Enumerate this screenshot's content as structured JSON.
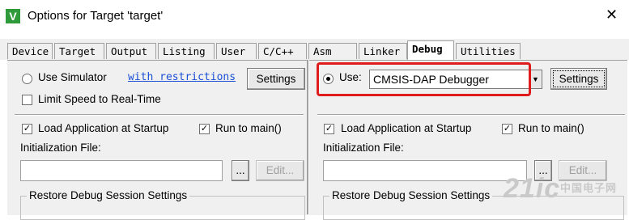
{
  "window": {
    "title": "Options for Target 'target'",
    "close_glyph": "✕",
    "app_icon_glyph": "V"
  },
  "tabs": [
    {
      "label": "Device",
      "active": false
    },
    {
      "label": "Target",
      "active": false
    },
    {
      "label": "Output",
      "active": false
    },
    {
      "label": "Listing",
      "active": false
    },
    {
      "label": "User",
      "active": false
    },
    {
      "label": "C/C++",
      "active": false
    },
    {
      "label": "Asm",
      "active": false
    },
    {
      "label": "Linker",
      "active": false
    },
    {
      "label": "Debug",
      "active": true
    },
    {
      "label": "Utilities",
      "active": false
    }
  ],
  "left": {
    "use_simulator_label": "Use Simulator",
    "with_restrictions_link": "with restrictions",
    "settings_button": "Settings",
    "limit_speed_label": "Limit Speed to Real-Time",
    "load_app_label": "Load Application at Startup",
    "run_to_main_label": "Run to main()",
    "init_file_label": "Initialization File:",
    "init_file_value": "",
    "browse_button": "...",
    "edit_button": "Edit...",
    "restore_group_title": "Restore Debug Session Settings"
  },
  "right": {
    "use_label": "Use:",
    "debugger_selected": "CMSIS-DAP Debugger",
    "settings_button": "Settings",
    "load_app_label": "Load Application at Startup",
    "run_to_main_label": "Run to main()",
    "init_file_label": "Initialization File:",
    "init_file_value": "",
    "browse_button": "...",
    "edit_button": "Edit...",
    "restore_group_title": "Restore Debug Session Settings"
  },
  "state": {
    "use_simulator_selected": false,
    "use_debugger_selected": true,
    "limit_speed_checked": false,
    "left_load_app_checked": true,
    "left_run_to_main_checked": true,
    "right_load_app_checked": true,
    "right_run_to_main_checked": true
  },
  "watermark": {
    "text": "21ic",
    "subtext": "中国电子网"
  },
  "colors": {
    "highlight": "#e01b1b",
    "link": "#1a4fd6",
    "app_icon": "#2e9a3a"
  }
}
